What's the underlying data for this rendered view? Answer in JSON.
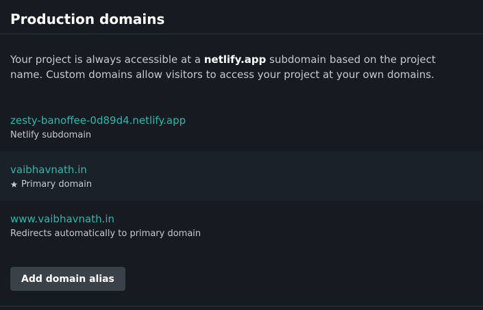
{
  "section": {
    "title": "Production domains",
    "description_before": "Your project is always accessible at a ",
    "description_strong": "netlify.app",
    "description_after": " subdomain based on the project name. Custom domains allow visitors to access your project at your own domains."
  },
  "domains": [
    {
      "name": "zesty-banoffee-0d89d4.netlify.app",
      "note": "Netlify subdomain",
      "icon": null
    },
    {
      "name": "vaibhavnath.in",
      "note": "Primary domain",
      "icon": "star-icon"
    },
    {
      "name": "www.vaibhavnath.in",
      "note": "Redirects automatically to primary domain",
      "icon": null
    }
  ],
  "actions": {
    "add_alias_label": "Add domain alias"
  },
  "colors": {
    "background": "#161b22",
    "link": "#31b5ac",
    "button": "#3a4149",
    "alt_row": "#1b2129"
  }
}
